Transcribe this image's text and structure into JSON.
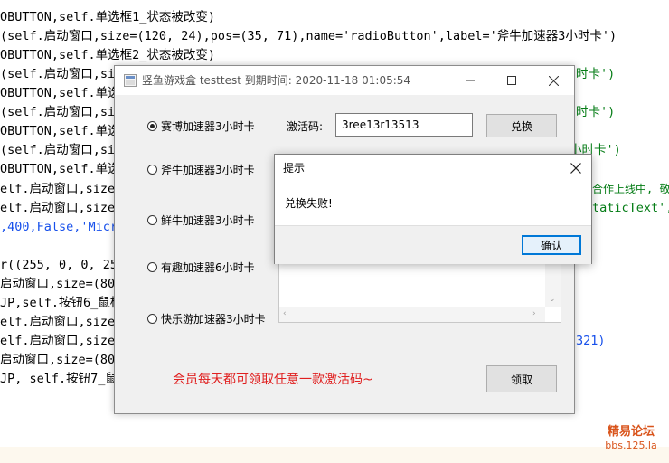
{
  "editor": {
    "lines": [
      "OBUTTON,self.单选框1_状态被改变)",
      "(self.启动窗口,size=(120, 24),pos=(35, 71),name='radioButton',label='斧牛加速器3小时卡')",
      "OBUTTON,self.单选框2_状态被改变)",
      "(self.启动窗口,siz",
      "OBUTTON,self.单选",
      "(self.启动窗口,siz",
      "OBUTTON,self.单选",
      "(self.启动窗口,siz",
      "OBUTTON,self.单选",
      "elf.启动窗口,size=(",
      "elf.启动窗口,size=(",
      ",400,False,'Micro",
      "",
      "r((255, 0, 0, 25",
      "启动窗口,size=(80,",
      "JP,self.按钮6_鼠标",
      "elf.启动窗口,size=",
      "elf.启动窗口,size=",
      "启动窗口,size=(80,",
      "JP, self.按钮7_鼠标"
    ],
    "right_fragments": [
      "时卡')",
      "时卡')",
      "小时卡')",
      "合作上线中, 敬",
      "taticText',s",
      "321)"
    ],
    "watermark_title": "精易论坛",
    "watermark_url": "bbs.125.la"
  },
  "main_window": {
    "title": "竖鱼游戏盒 testtest 到期时间: 2020-11-18 01:05:54",
    "minimize": "—",
    "maximize": "☐",
    "radios": [
      {
        "label": "赛博加速器3小时卡",
        "checked": true
      },
      {
        "label": "斧牛加速器3小时卡",
        "checked": false
      },
      {
        "label": "鲜牛加速器3小时卡",
        "checked": false
      },
      {
        "label": "有趣加速器6小时卡",
        "checked": false
      },
      {
        "label": "快乐游加速器3小时卡",
        "checked": false
      }
    ],
    "code_label": "激活码:",
    "code_value": "3ree13r13513",
    "redeem_button": "兑换",
    "promo_text": "会员每天都可领取任意一款激活码~",
    "claim_button": "领取"
  },
  "message_box": {
    "title": "提示",
    "message": "兑换失败!",
    "ok_button": "确认"
  }
}
